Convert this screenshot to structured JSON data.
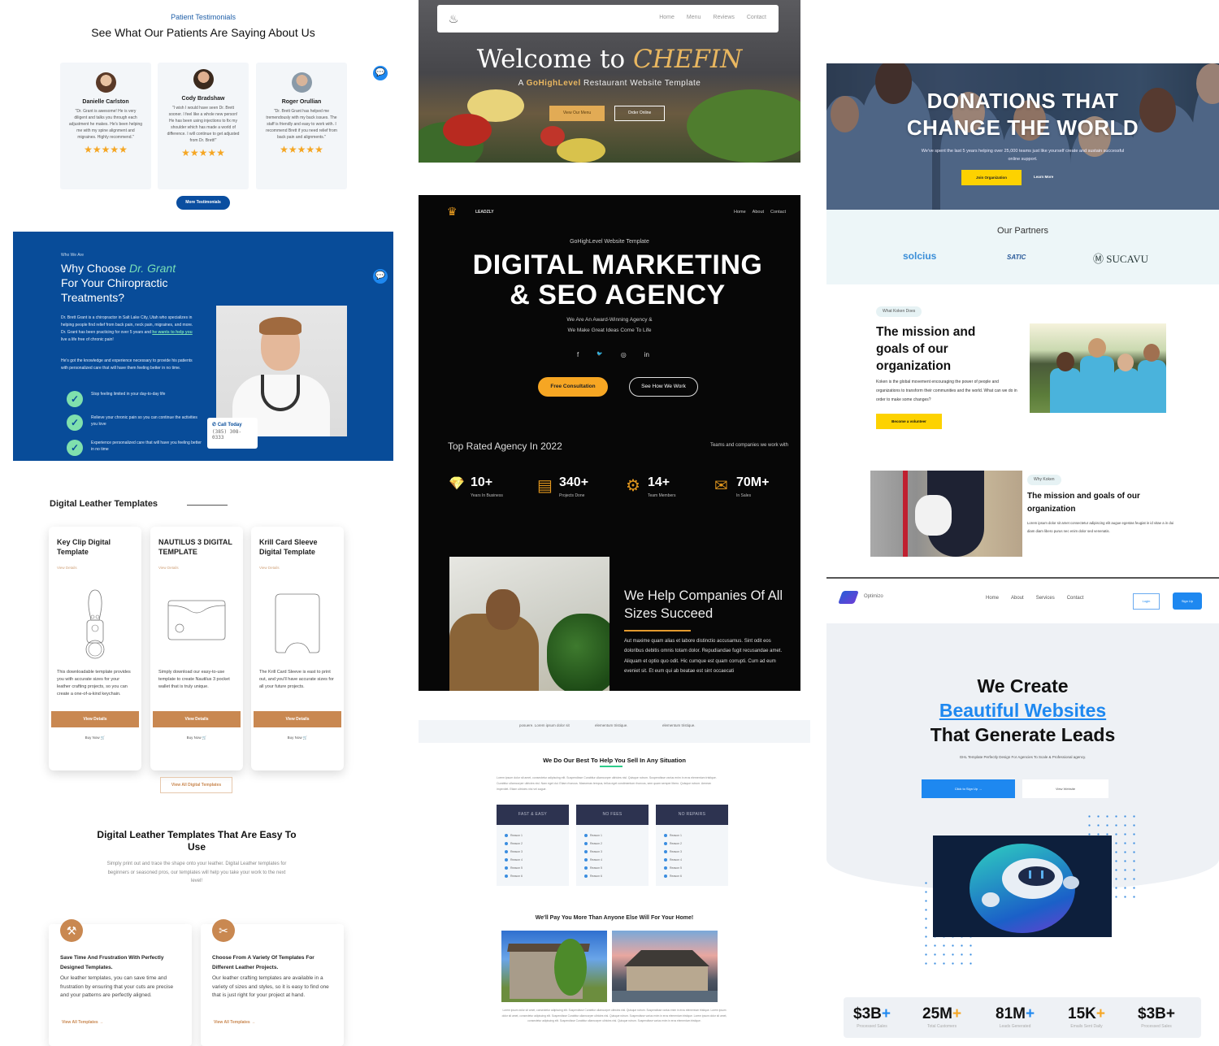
{
  "testimonials": {
    "eyebrow": "Patient Testimonials",
    "title": "See What Our Patients Are Saying About Us",
    "cards": [
      {
        "name": "Danielle Carlston",
        "quote": "\"Dr. Grant is awesome! He is very diligent and talks you through each adjustment he makes. He's been helping me with my spine alignment and migraines. Highly recommend.\"",
        "stars": "★★★★★",
        "rating": 5
      },
      {
        "name": "Cody Bradshaw",
        "quote": "\"I wish I would have seen Dr. Brett sooner. I feel like a whole new person! He has been using injections to fix my shoulder which has made a world of difference. I will continue to get adjusted from Dr. Brett!\"",
        "stars": "★★★★★",
        "rating": 5
      },
      {
        "name": "Roger Orullian",
        "quote": "\"Dr. Brett Grant has helped me tremendously with my back issues. The staff is friendly and easy to work with. I recommend Brett if you need relief from back pain and alignments.\"",
        "stars": "★★★★★",
        "rating": 5
      }
    ],
    "more_button": "More Testimonials",
    "chat_icon": "💬"
  },
  "chiro": {
    "eyebrow": "Who We Are",
    "title_prefix": "Why Choose ",
    "title_highlight": "Dr. Grant",
    "title_suffix": "For Your Chiropractic Treatments?",
    "para1_start": "Dr. Brett Grant is a chiropractor in Salt Lake City, Utah who specializes in helping people find relief from back pain, neck pain, migraines, and more. Dr. Grant has been practicing for over 5 years and ",
    "para1_link": "he wants to help you",
    "para1_end": " live a life free of chronic pain!",
    "para2": "He's got the knowledge and experience necessary to provide his patients with personalized care that will have them feeling better in no time.",
    "checks": [
      "Stop feeling limited in your day-to-day life",
      "Relieve your chronic pain so you can continue the activities you love",
      "Experience personalized care that will have you feeling better in no time"
    ],
    "call_label": "Call Today",
    "call_phone": "(385) 308-0333",
    "chat_icon": "💬"
  },
  "leather": {
    "section_title": "Digital Leather Templates",
    "cards": [
      {
        "title": "Key Clip Digital Template",
        "link": "View Details",
        "desc": "This downloadable template provides you with accurate sizes for your leather crafting projects, so you can create a one-of-a-kind keychain.",
        "button": "View Details",
        "buy": "Buy Now 🛒"
      },
      {
        "title": "NAUTILUS 3 DIGITAL TEMPLATE",
        "link": "View Details",
        "desc": "Simply download our easy-to-use template to create Nautilus 3 pocket wallet that is truly unique.",
        "button": "View Details",
        "buy": "Buy Now 🛒"
      },
      {
        "title": "Krill Card Sleeve Digital Template",
        "link": "View Details",
        "desc": "The Krill Card Sleeve is east to print out, and you'll have accurate sizes for all your future projects.",
        "button": "View Details",
        "buy": "Buy Now 🛒"
      }
    ],
    "view_all": "View All Digital Templates",
    "easy_title": "Digital Leather Templates That Are Easy To Use",
    "easy_desc": "Simply print out and trace the shape onto your leather. Digital Leather templates for beginners or seasoned pros, our templates will help you take your work to the next level!",
    "features": [
      {
        "icon": "craftsman-icon",
        "glyph": "⚒",
        "title": "Save Time And Frustration With Perfectly Designed Templates.",
        "desc": "Our leather templates, you can save time and frustration by ensuring that your cuts are precise and your patterns are perfectly aligned.",
        "link": "View All Templates →"
      },
      {
        "icon": "cutting-icon",
        "glyph": "✂",
        "title": "Choose From A Variety Of Templates For Different Leather Projects.",
        "desc": "Our leather crafting templates are available in a variety of sizes and styles, so it is easy to find one that is just right for your project at hand.",
        "link": "View All Templates →"
      }
    ],
    "accent": "#c98851"
  },
  "chefin": {
    "nav": [
      "Home",
      "Menu",
      "Reviews",
      "Contact"
    ],
    "title_prefix": "Welcome to ",
    "title_brand": "CHEFIN",
    "sub_prefix": "A ",
    "sub_brand": "GoHighLevel",
    "sub_suffix": " Restaurant Website Template",
    "btn_menu": "View Our Menu",
    "btn_order": "Order Online",
    "accent": "#e9b760"
  },
  "agency": {
    "brand": "LEADZLY",
    "nav": [
      "Home",
      "About",
      "Contact"
    ],
    "eyebrow": "GoHighLevel Website Template",
    "title_line1": "DIGITAL MARKETING",
    "title_line2": "& SEO AGENCY",
    "tagline_line1": "We Are An Award-Winning Agency &",
    "tagline_line2": "We Make Great Ideas Come To Life",
    "social": [
      "f",
      "🐦",
      "◎",
      "in"
    ],
    "cta_primary": "Free Consultation",
    "cta_secondary": "See How We Work",
    "rated": "Top Rated Agency In 2022",
    "teams": "Teams and companies we work with",
    "stats": [
      {
        "icon": "diamond-icon",
        "glyph": "💎",
        "value": "10+",
        "label": "Years In Business"
      },
      {
        "icon": "chat-icon",
        "glyph": "▤",
        "value": "340+",
        "label": "Projects Done"
      },
      {
        "icon": "gear-icon",
        "glyph": "⚙",
        "value": "14+",
        "label": "Team Members"
      },
      {
        "icon": "envelope-icon",
        "glyph": "✉",
        "value": "70M+",
        "label": "In Sales"
      }
    ],
    "help_title": "We Help Companies Of All Sizes Succeed",
    "help_desc": "Aut maxime quam alias et labore distinctio accusamus. Sint odit eos doloribus debitis omnis totam dolor. Repudiandae fugit recusandae amet. Aliquam et optio quo odit. Hic cumque est quam corrupti. Cum ad eum eveniet sit. Et eum qui ab beatae est sint occaecati",
    "accent": "#f6a623"
  },
  "realestate": {
    "strip": [
      "posuere. Lorem ipsum dolor sit",
      "elementum tristique.",
      "elementum tristique."
    ],
    "heading": "We Do Our Best To Help You Sell In Any Situation",
    "para": "Lorem ipsum dolor sit amet, consectetur adipiscing elit. Suspendisse Curabitur ullamcorper ultricies nisl. Quisque rutrum. Suspendisse varius enim in eros elementum tristique. Curabitur ullamcorper ultricies nisl. Nam eget dui. Etiam rhoncus. Maecenas tempus, tellus eget condimentum rhoncus, sem quam semper libero. Quisque rutrum. Aenean imperdiet. Etiam ultricies nisi vel augue.",
    "columns": [
      {
        "title": "FAST & EASY",
        "items": [
          "Reason 1",
          "Reason 2",
          "Reason 3",
          "Reason 4",
          "Reason 5",
          "Reason 6"
        ]
      },
      {
        "title": "NO FEES",
        "items": [
          "Reason 1",
          "Reason 2",
          "Reason 3",
          "Reason 4",
          "Reason 5",
          "Reason 6"
        ]
      },
      {
        "title": "NO REPAIRS",
        "items": [
          "Reason 1",
          "Reason 2",
          "Reason 3",
          "Reason 4",
          "Reason 5",
          "Reason 6"
        ]
      }
    ],
    "heading2": "We'll Pay You More Than Anyone Else Will For Your Home!",
    "bottom": "Lorem ipsum dolor sit amet, consectetur adipiscing elit. Suspendisse Curabitur ullamcorper ultricies nisl. Quisque rutrum. Suspendisse varius enim in eros elementum tristique. Lorem ipsum dolor sit amet, consectetur adipiscing elit. Suspendisse Curabitur ullamcorper ultricies nisl. Quisque rutrum. Suspendisse varius enim in eros elementum tristique. Lorem ipsum dolor sit amet, consectetur adipiscing elit. Suspendisse Curabitur ullamcorper ultricies nisl. Quisque rutrum. Suspendisse varius enim in eros elementum tristique."
  },
  "donations": {
    "title_line1": "DONATIONS THAT",
    "title_line2": "CHANGE THE WORLD",
    "sub": "We've spent the last 5 years helping over 25,000 teams just like yourself create and sustain successful online support.",
    "join": "Join Organization",
    "learn": "Learn More",
    "partners_title": "Our Partners",
    "partners": [
      "solcius",
      "SATIC",
      "Ⓜ SUCAVU"
    ],
    "pill1": "What Koken Does",
    "mission_title": "The mission and goals of our organization",
    "mission_desc": "Koken is the global movement encouraging the power of people and organizations to transform their communities and the world. What can we do in order to make some changes?",
    "volunteer": "Become a volunteer",
    "pill2": "Why Koken",
    "mission2_title": "The mission and goals of our organization",
    "mission2_desc": "Lorem ipsum dolor sit amet consectetur adipiscing elit augue egestas feugiat in id vitae a in dui diam diam libero purus nec enim dolor sed venenatis.",
    "accent": "#fdd200"
  },
  "optimizo": {
    "brand": "Optimizo",
    "nav": [
      "Home",
      "About",
      "Services",
      "Contact"
    ],
    "login": "Login",
    "signup": "Sign Up",
    "title_line1": "We Create",
    "title_line2": "Beautiful Websites",
    "title_line3": "That Generate Leads",
    "sub": "GHL Template Perfectly Design For Agencies To Scale & Professional agency.",
    "cta_primary": "Click to Sign Up →",
    "cta_secondary": "View Website",
    "stats": [
      {
        "value": "$3B",
        "plus": "+",
        "plus_color": "#1e88f0",
        "label": "Processed Sales"
      },
      {
        "value": "25M",
        "plus": "+",
        "plus_color": "#f6a623",
        "label": "Total Customers"
      },
      {
        "value": "81M",
        "plus": "+",
        "plus_color": "#1e88f0",
        "label": "Leads Generated"
      },
      {
        "value": "15K",
        "plus": "+",
        "plus_color": "#f6a623",
        "label": "Emails Sent Daily"
      },
      {
        "value": "$3B",
        "plus": "+",
        "plus_color": "#111111",
        "label": "Processed Sales"
      }
    ],
    "accent": "#1e88f0"
  }
}
